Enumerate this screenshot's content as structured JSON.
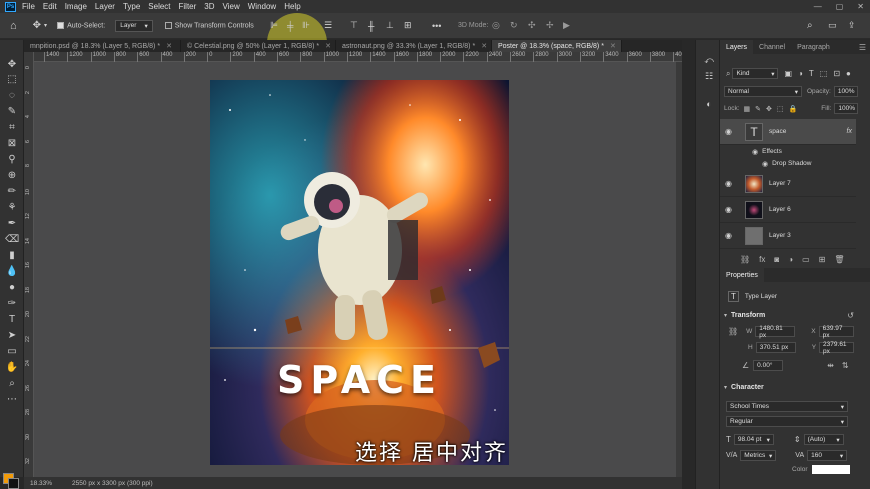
{
  "menu": {
    "logo": "Ps",
    "items": [
      "File",
      "Edit",
      "Image",
      "Layer",
      "Type",
      "Select",
      "Filter",
      "3D",
      "View",
      "Window",
      "Help"
    ],
    "window_controls": [
      "—",
      "▢",
      "✕"
    ]
  },
  "options": {
    "auto_select_label": "Auto-Select:",
    "auto_select_value": "Layer",
    "show_transform_label": "Show Transform Controls",
    "mode_3d_label": "3D Mode:"
  },
  "tabs": [
    {
      "label": "mnpition.psd @ 18.3% (Layer 5, RGB/8) *",
      "active": false
    },
    {
      "label": "© Celestial.png @ 50% (Layer 1, RGB/8) *",
      "active": false
    },
    {
      "label": "astronaut.png @ 33.3% (Layer 1, RGB/8) *",
      "active": false
    },
    {
      "label": "Poster @ 18.3% (space, RGB/8) *",
      "active": true
    }
  ],
  "ruler": {
    "h_ticks": [
      "1400",
      "1200",
      "1000",
      "800",
      "600",
      "400",
      "200",
      "0",
      "200",
      "400",
      "600",
      "800",
      "1000",
      "1200",
      "1400",
      "1600",
      "1800",
      "2000",
      "2200",
      "2400",
      "2600",
      "2800",
      "3000",
      "3200",
      "3400",
      "3600",
      "3800",
      "4000"
    ],
    "v_ticks": [
      "0",
      "2",
      "4",
      "6",
      "8",
      "10",
      "12",
      "14",
      "16",
      "18",
      "20",
      "22",
      "24",
      "26",
      "28",
      "30",
      "32"
    ]
  },
  "poster": {
    "title": "SPACE"
  },
  "subtitle": "选择 居中对齐",
  "status": {
    "zoom": "18.33%",
    "doc_info": "2550 px x 3300 px (300 ppi)"
  },
  "layers_panel": {
    "tabs": [
      "Layers",
      "Channel",
      "Paragraph"
    ],
    "filter_kind": "Kind",
    "blend_mode": "Normal",
    "opacity_label": "Opacity:",
    "opacity_value": "100%",
    "lock_label": "Lock:",
    "fill_label": "Fill:",
    "fill_value": "100%",
    "layers": [
      {
        "name": "space",
        "type": "text",
        "selected": true,
        "fx": "fx"
      },
      {
        "name": "Layer 7",
        "type": "image"
      },
      {
        "name": "Layer 6",
        "type": "image"
      },
      {
        "name": "Layer 3",
        "type": "image"
      }
    ],
    "effects_label": "Effects",
    "drop_shadow_label": "Drop Shadow"
  },
  "properties": {
    "title": "Properties",
    "layer_type": "Type Layer",
    "transform_label": "Transform",
    "w_label": "W",
    "w_value": "1480.81 px",
    "x_label": "X",
    "x_value": "639.97 px",
    "h_label": "H",
    "h_value": "370.51 px",
    "y_label": "Y",
    "y_value": "2379.61 px",
    "angle_value": "0.00°",
    "character_label": "Character",
    "font_family": "School Times",
    "font_style": "Regular",
    "font_size": "98.04 pt",
    "leading": "(Auto)",
    "kerning": "Metrics",
    "tracking": "160",
    "color_label": "Color"
  },
  "colors": {
    "accent": "#31a8ff",
    "foreground": "#f29b0a",
    "background": "#111111",
    "cursor_highlight": "#d6ce28"
  }
}
